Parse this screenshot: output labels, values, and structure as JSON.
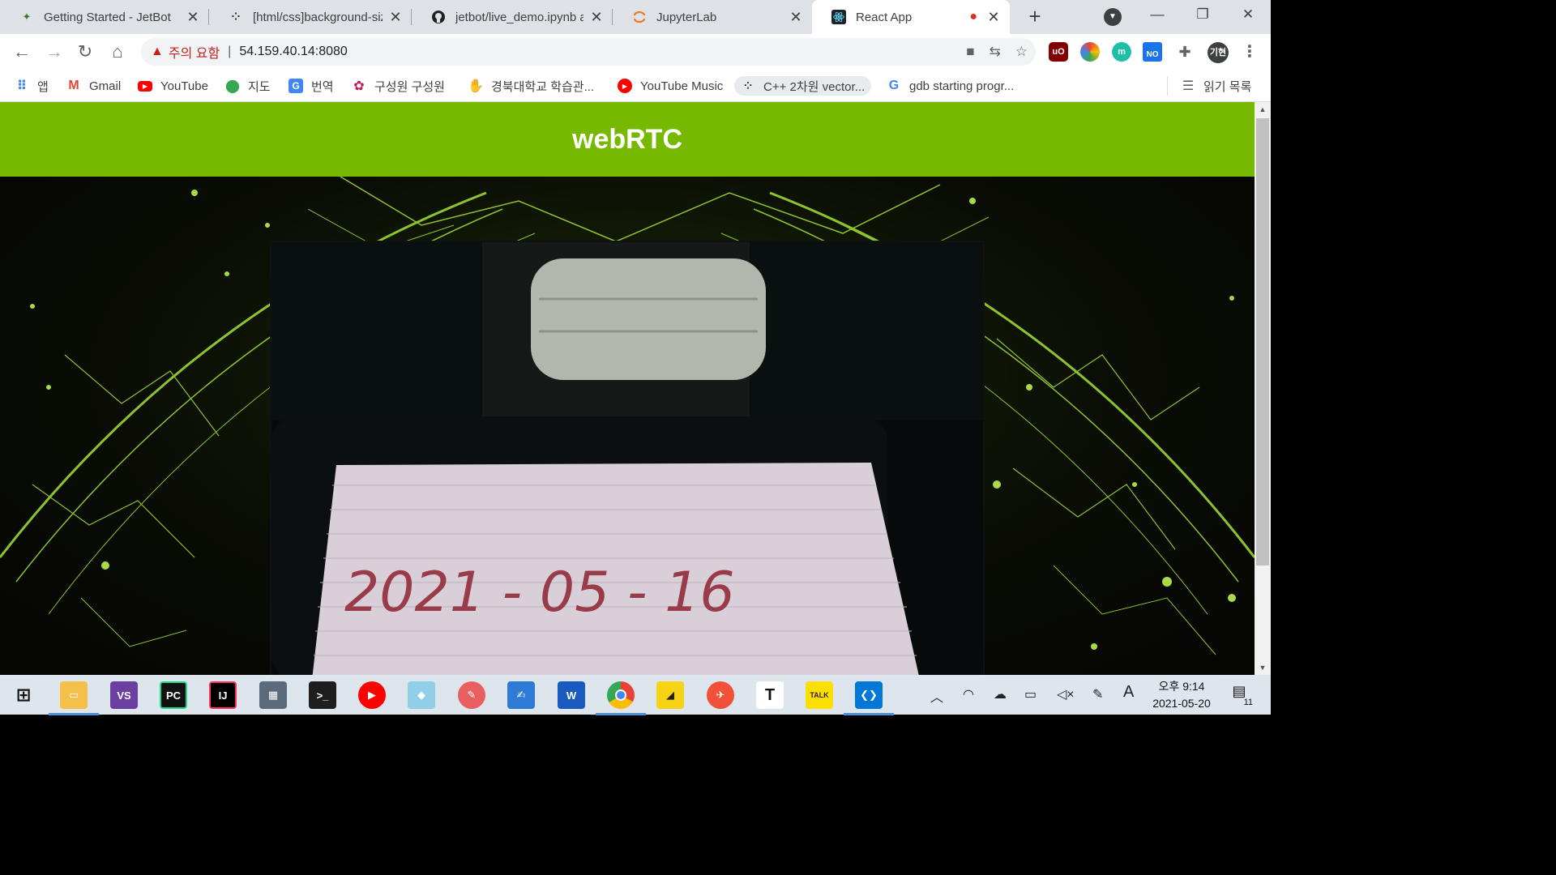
{
  "browser": {
    "tabs": [
      {
        "title": "Getting Started - JetBot",
        "icon": "jetbot-icon"
      },
      {
        "title": "[html/css]background-size",
        "icon": "tistory-icon"
      },
      {
        "title": "jetbot/live_demo.ipynb at",
        "icon": "github-icon"
      },
      {
        "title": "JupyterLab",
        "icon": "jupyter-icon"
      },
      {
        "title": "React App",
        "icon": "react-icon",
        "recording": "●"
      }
    ],
    "address": {
      "warning_icon": "▲",
      "warning_text": "주의 요함",
      "separator": "|",
      "url": "54.159.40.14:8080"
    },
    "bookmarks": [
      {
        "label": "앱",
        "icon": "apps-grid-icon"
      },
      {
        "label": "Gmail",
        "icon": "gmail-icon"
      },
      {
        "label": "YouTube",
        "icon": "youtube-icon"
      },
      {
        "label": "지도",
        "icon": "maps-icon"
      },
      {
        "label": "번역",
        "icon": "translate-icon"
      },
      {
        "label": "구성원 구성원",
        "icon": "university-seal-icon"
      },
      {
        "label": "경북대학교 학습관...",
        "icon": "knu-icon"
      },
      {
        "label": "YouTube Music",
        "icon": "youtube-music-icon"
      },
      {
        "label": "C++ 2차원 vector...",
        "icon": "tistory-icon"
      },
      {
        "label": "gdb starting progr...",
        "icon": "google-icon"
      }
    ],
    "reading_list": "읽기 목록",
    "profile_initials": "기현",
    "ext_no_label": "NO"
  },
  "page": {
    "header_title": "webRTC",
    "video_handwriting": "2021 - 05 - 16"
  },
  "taskbar": {
    "apps": [
      "file-explorer",
      "visual-studio",
      "pycharm",
      "intellij",
      "calculator",
      "terminal",
      "youtube-music",
      "notepad",
      "paint",
      "editor",
      "word",
      "chrome",
      "sticky-notes",
      "swift",
      "typora",
      "kakaotalk",
      "vscode"
    ],
    "clock_time": "오후 9:14",
    "clock_date": "2021-05-20",
    "ime_label": "A",
    "notification_count": "11"
  },
  "colors": {
    "header_bg": "#76b900",
    "accent_green": "#b8ff3c",
    "tabstrip_bg": "#dee1e6",
    "warning_red": "#c5221f",
    "taskbar_bg": "#dde5ed"
  }
}
